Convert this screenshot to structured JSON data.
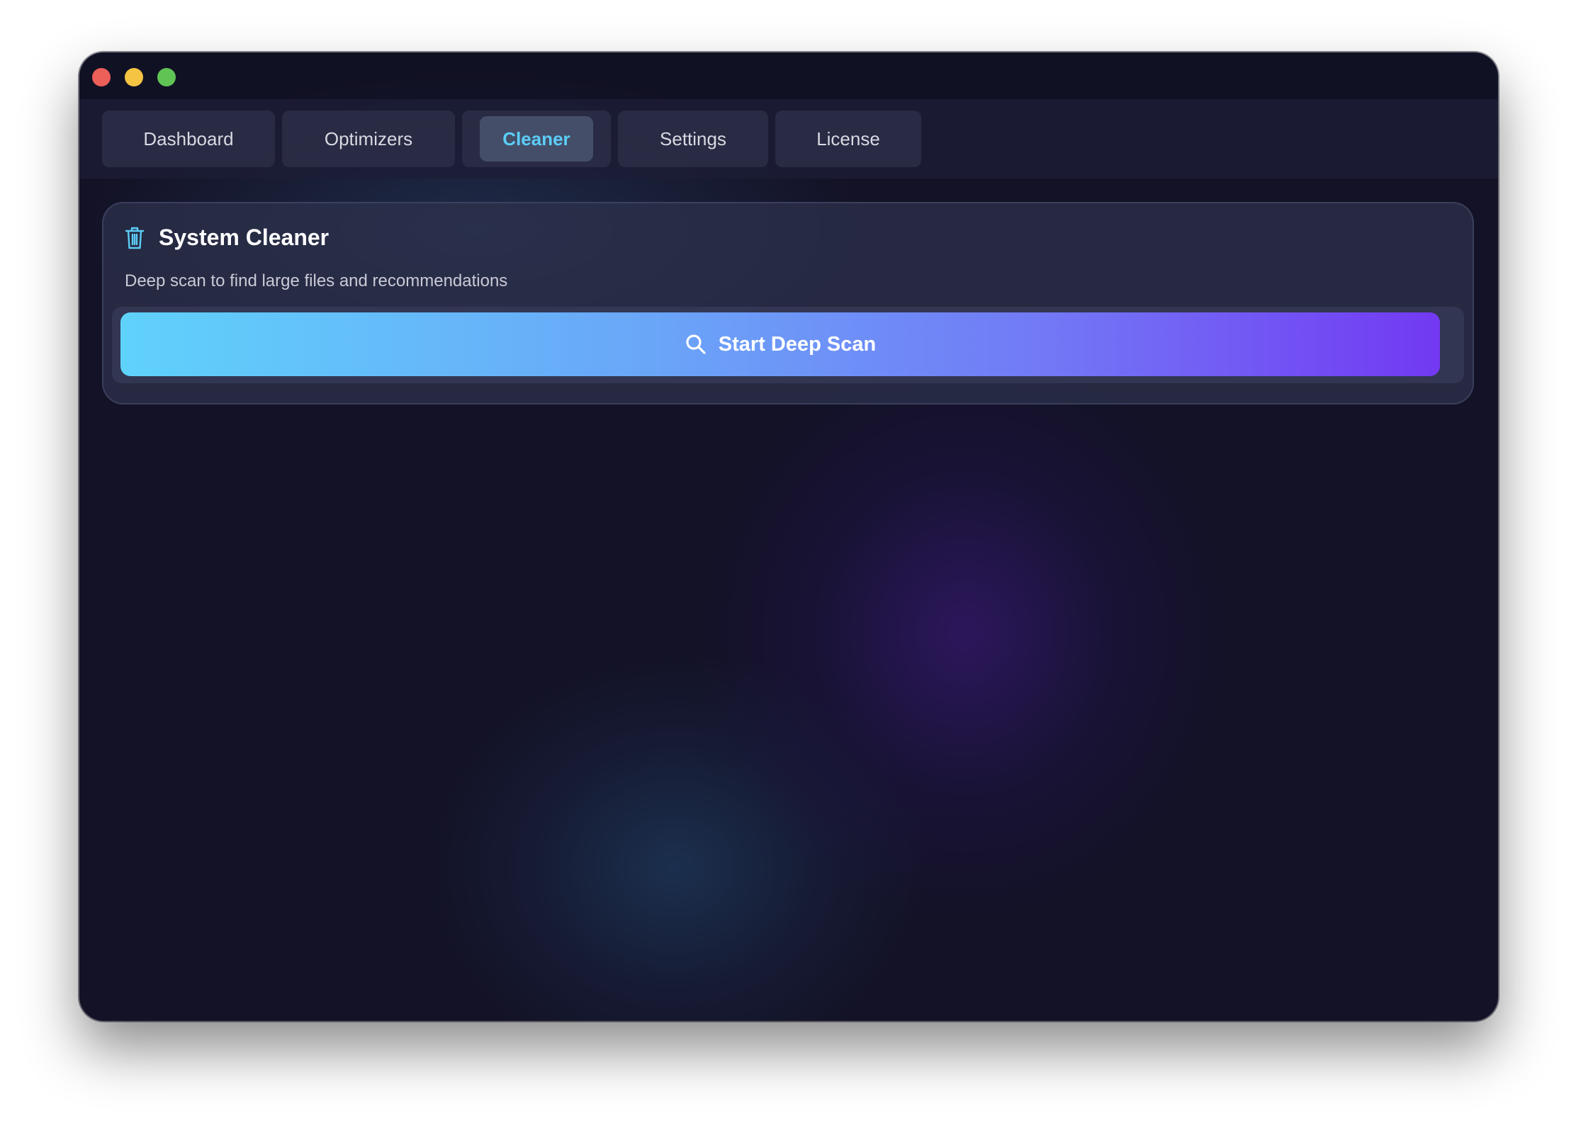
{
  "tabs": [
    {
      "label": "Dashboard",
      "active": false
    },
    {
      "label": "Optimizers",
      "active": false
    },
    {
      "label": "Cleaner",
      "active": true
    },
    {
      "label": "Settings",
      "active": false
    },
    {
      "label": "License",
      "active": false
    }
  ],
  "cleaner": {
    "title": "System Cleaner",
    "subtitle": "Deep scan to find large files and recommendations",
    "icon": "trash-icon",
    "scan_button_label": "Start Deep Scan",
    "scan_button_icon": "search-icon"
  },
  "colors": {
    "accent": "#5ccdf6",
    "gradient_start": "#5fd2fb",
    "gradient_end": "#7239f2",
    "background": "#131226"
  }
}
